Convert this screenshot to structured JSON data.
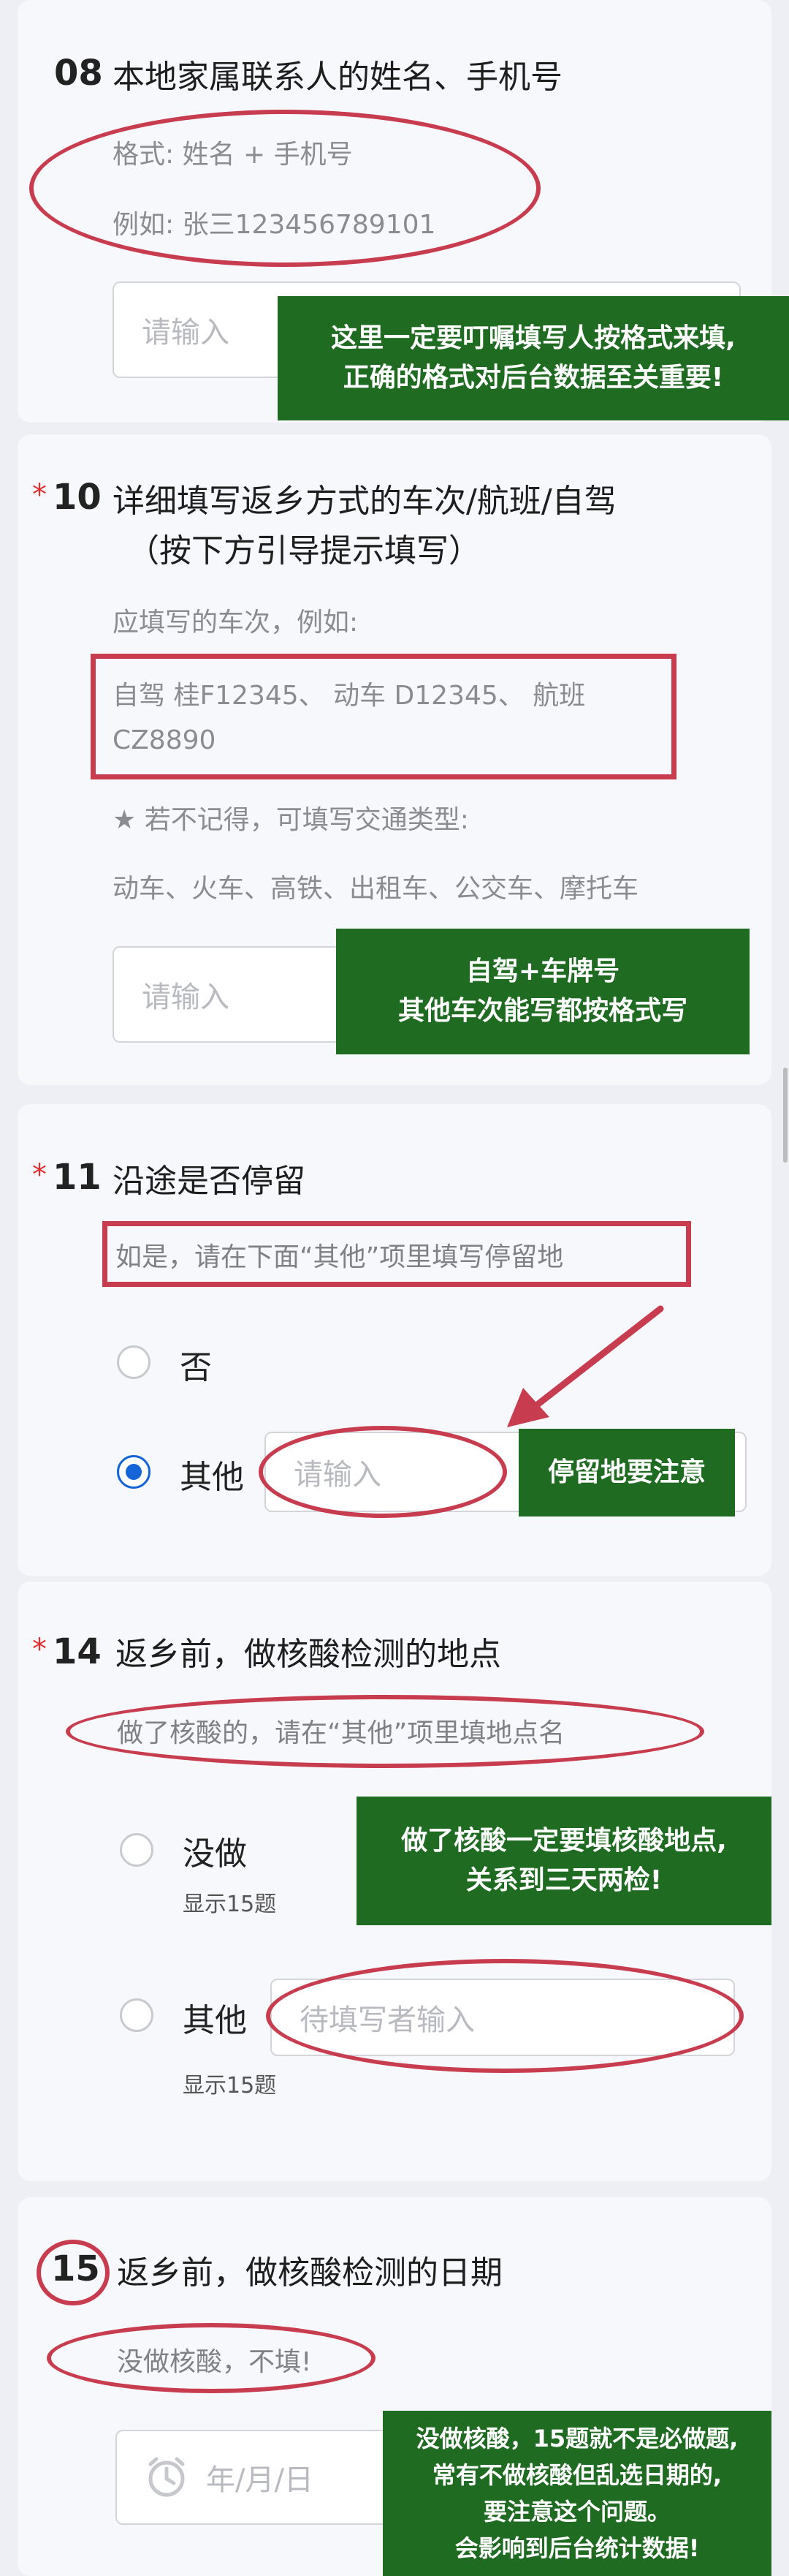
{
  "q08": {
    "number": "08",
    "title": "本地家属联系人的姓名、手机号",
    "hint_format": "格式: 姓名 + 手机号",
    "hint_example": "例如:  张三123456789101",
    "placeholder": "请输入",
    "note": [
      "这里一定要叮嘱填写人按格式来填,",
      "正确的格式对后台数据至关重要!"
    ]
  },
  "q10": {
    "required": "*",
    "number": "10",
    "title_line1": "详细填写返乡方式的车次/航班/自驾",
    "title_line2": "（按下方引导提示填写）",
    "hint_intro": "应填写的车次，例如:",
    "hint_example_line1": "自驾 桂F12345、 动车 D12345、 航班",
    "hint_example_line2": "CZ8890",
    "hint_star": "★ 若不记得，可填写交通类型:",
    "hint_types": "动车、火车、高铁、出租车、公交车、摩托车",
    "placeholder": "请输入",
    "note": [
      "自驾+车牌号",
      "其他车次能写都按格式写"
    ]
  },
  "q11": {
    "required": "*",
    "number": "11",
    "title": "沿途是否停留",
    "hint": "如是，请在下面“其他”项里填写停留地",
    "option_no": "否",
    "option_other": "其他",
    "placeholder": "请输入",
    "note": "停留地要注意"
  },
  "q14": {
    "required": "*",
    "number": "14",
    "title": "返乡前，做核酸检测的地点",
    "hint": "做了核酸的，请在“其他”项里填地点名",
    "option_no": "没做",
    "option_no_sub": "显示15题",
    "option_other": "其他",
    "option_other_sub": "显示15题",
    "placeholder": "待填写者输入",
    "note": [
      "做了核酸一定要填核酸地点,",
      "关系到三天两检!"
    ]
  },
  "q15": {
    "number": "15",
    "title": "返乡前，做核酸检测的日期",
    "hint": "没做核酸，不填!",
    "date_placeholder": "年/月/日",
    "note": [
      "没做核酸，15题就不是必做题,",
      "常有不做核酸但乱选日期的,",
      "要注意这个问题。",
      "会影响到后台统计数据!"
    ]
  },
  "colors": {
    "annotation_red": "#c83c4f",
    "note_green": "#1f6b22",
    "radio_blue": "#1565d8",
    "required_red": "#e02f2f"
  },
  "icons": [
    "clock-icon",
    "arrow-icon"
  ]
}
